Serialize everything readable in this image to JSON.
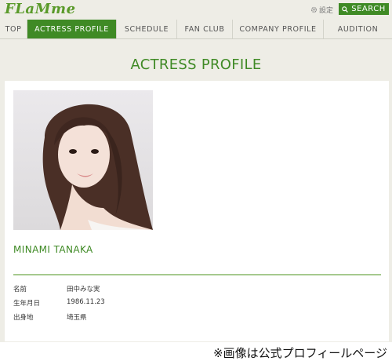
{
  "header": {
    "logo": "FLaMme",
    "settings_label": "設定",
    "search_label": "SEARCH"
  },
  "nav": {
    "items": [
      {
        "label": "TOP"
      },
      {
        "label": "ACTRESS PROFILE"
      },
      {
        "label": "SCHEDULE"
      },
      {
        "label": "FAN CLUB"
      },
      {
        "label": "COMPANY PROFILE"
      },
      {
        "label": "AUDITION"
      }
    ],
    "active": "ACTRESS PROFILE"
  },
  "page": {
    "title": "ACTRESS PROFILE"
  },
  "profile": {
    "name": "MINAMI TANAKA",
    "details": [
      {
        "key": "名前",
        "value": "田中みな実"
      },
      {
        "key": "生年月日",
        "value": "1986.11.23"
      },
      {
        "key": "出身地",
        "value": "埼玉県"
      }
    ]
  },
  "caption": "※画像は公式プロフィールページ",
  "colors": {
    "accent": "#3f8a25",
    "background": "#eeede6",
    "divider": "#a6c98e"
  }
}
